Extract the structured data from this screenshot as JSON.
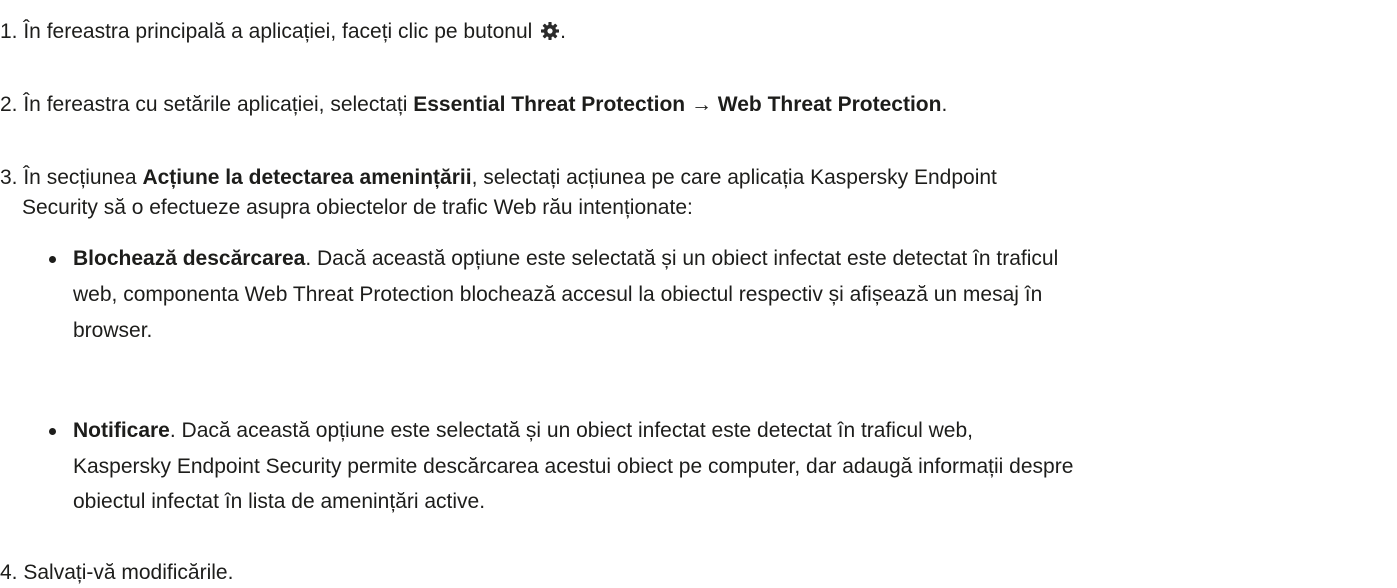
{
  "steps": [
    {
      "number": "1.",
      "before": " În fereastra principală a aplicației, faceți clic pe butonul ",
      "icon": "gear-icon",
      "after": "."
    },
    {
      "number": "2.",
      "before": " În fereastra cu setările aplicației, selectați ",
      "bold": "Essential Threat Protection → Web Threat Protection",
      "after": "."
    },
    {
      "number": "3.",
      "before": " În secțiunea ",
      "bold": "Acțiune la detectarea amenințării",
      "after_line1": ", selectați acțiunea pe care aplicația Kaspersky Endpoint",
      "line2": "Security să o efectueze asupra obiectelor de trafic Web rău intenționate:"
    },
    {
      "number": "4.",
      "text": " Salvați-vă modificările."
    }
  ],
  "options": [
    {
      "bold": "Blochează descărcarea",
      "line1": ". Dacă această opțiune este selectată și un obiect infectat este detectat în traficul",
      "line2": "web, componenta Web Threat Protection blochează accesul la obiectul respectiv și afișează un mesaj în",
      "line3": "browser."
    },
    {
      "bold": "Notificare",
      "line1": ". Dacă această opțiune este selectată și un obiect infectat este detectat în traficul web,",
      "line2": "Kaspersky Endpoint Security permite descărcarea acestui obiect pe computer, dar adaugă informații despre",
      "line3": "obiectul infectat în lista de amenințări active."
    }
  ]
}
